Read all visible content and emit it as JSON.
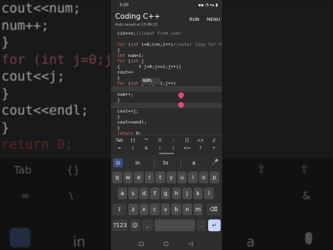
{
  "bg": {
    "code_lines": [
      {
        "num": "",
        "text": "cout<<num;"
      },
      {
        "num": "",
        "text": "num++;"
      },
      {
        "num": "",
        "text": "}"
      },
      {
        "num": "",
        "text": "for (int j=0;j<=i;j++){"
      },
      {
        "num": "",
        "text": "cout<<j;"
      },
      {
        "num": "",
        "text": "}"
      },
      {
        "num": "",
        "text": "cout<<endl;"
      },
      {
        "num": "",
        "text": "}"
      },
      {
        "num": "",
        "text": "return 0;"
      }
    ],
    "kb_labels": [
      "Tab",
      "{}",
      "=",
      "\\",
      "&",
      "in",
      "a"
    ]
  },
  "status": {
    "time": "3:50",
    "icons": "▪▪ ◔ ▾▴ ▮"
  },
  "app": {
    "title": "Coding C++",
    "autosave": "Auto saved at 13:49:22",
    "run": "RUN",
    "menu": "MENU"
  },
  "editor": {
    "lines": [
      {
        "n": "",
        "parts": [
          [
            "",
            "cin>>n;"
          ],
          [
            "c",
            "//input from user"
          ]
        ]
      },
      {
        "n": "",
        "parts": [
          [
            "",
            ""
          ]
        ]
      },
      {
        "n": "",
        "parts": [
          [
            "k",
            "for"
          ],
          [
            "",
            " ("
          ],
          [
            "t",
            "int"
          ],
          [
            "",
            " i=0;i<n;i++)"
          ],
          [
            "c",
            "//outer loop for ro"
          ]
        ]
      },
      {
        "n": "",
        "parts": [
          [
            "",
            "{"
          ]
        ]
      },
      {
        "n": "",
        "parts": [
          [
            "t",
            "int"
          ],
          [
            "",
            " num=1;"
          ]
        ]
      },
      {
        "n": "",
        "parts": [
          [
            "k",
            "for"
          ],
          [
            "",
            " ("
          ],
          [
            "t",
            "int"
          ],
          [
            "",
            " j"
          ]
        ]
      },
      {
        "n": "",
        "parts": [
          [
            "",
            "{"
          ],
          [
            "",
            "       t j=0;j<=i;j++){"
          ]
        ]
      },
      {
        "n": "",
        "parts": [
          [
            "",
            "cout<<"
          ],
          [
            "o",
            ""
          ]
        ]
      },
      {
        "n": "",
        "parts": [
          [
            "",
            "}"
          ]
        ]
      },
      {
        "n": "",
        "parts": [
          [
            "k",
            "for"
          ],
          [
            "",
            " ("
          ],
          [
            "t",
            "int"
          ],
          [
            "",
            " j=0;j<=i;j++)"
          ]
        ]
      },
      {
        "n": "22",
        "parts": [
          [
            "",
            "cout<<num;"
          ]
        ]
      },
      {
        "n": "",
        "parts": [
          [
            "",
            "num++;"
          ]
        ]
      },
      {
        "n": "",
        "parts": [
          [
            "",
            "}"
          ]
        ]
      },
      {
        "n": "",
        "parts": [
          [
            "k",
            "for"
          ],
          [
            "",
            " ("
          ],
          [
            "t",
            "int"
          ],
          [
            "",
            " j=i;j<n;j--)"
          ]
        ]
      },
      {
        "n": "",
        "parts": [
          [
            "",
            "cout<<j;"
          ]
        ]
      },
      {
        "n": "",
        "parts": [
          [
            "",
            "}"
          ]
        ]
      },
      {
        "n": "",
        "parts": [
          [
            "",
            "cout<<endl;"
          ]
        ]
      },
      {
        "n": "",
        "parts": [
          [
            "",
            "}"
          ]
        ]
      },
      {
        "n": "",
        "parts": [
          [
            "k",
            "return"
          ],
          [
            "",
            " 0;"
          ]
        ]
      }
    ],
    "autocomplete": "NUM;"
  },
  "symbols": {
    "row1": [
      "Tab",
      "{}",
      "\"\"",
      "()",
      ";",
      "[]",
      "<>",
      "//"
    ],
    "row2": [
      "=",
      "\\",
      "&",
      "!",
      "|",
      "<=",
      "?",
      "+"
    ]
  },
  "keyboard": {
    "suggestions": [
      "in",
      "to",
      "a"
    ],
    "row1": [
      "q",
      "w",
      "e",
      "r",
      "t",
      "y",
      "u",
      "i",
      "o",
      "p"
    ],
    "row2": [
      "a",
      "s",
      "d",
      "f",
      "g",
      "h",
      "j",
      "k",
      "l"
    ],
    "row3": [
      "z",
      "x",
      "c",
      "v",
      "b",
      "n",
      "m"
    ],
    "shift": "⇧",
    "backspace": "⌫",
    "num_key": "?123",
    "emoji": "☺",
    "comma": ",",
    "period": ".",
    "enter": "↵"
  },
  "nav": {
    "back": "◁",
    "home": "○",
    "recents": "▢"
  }
}
